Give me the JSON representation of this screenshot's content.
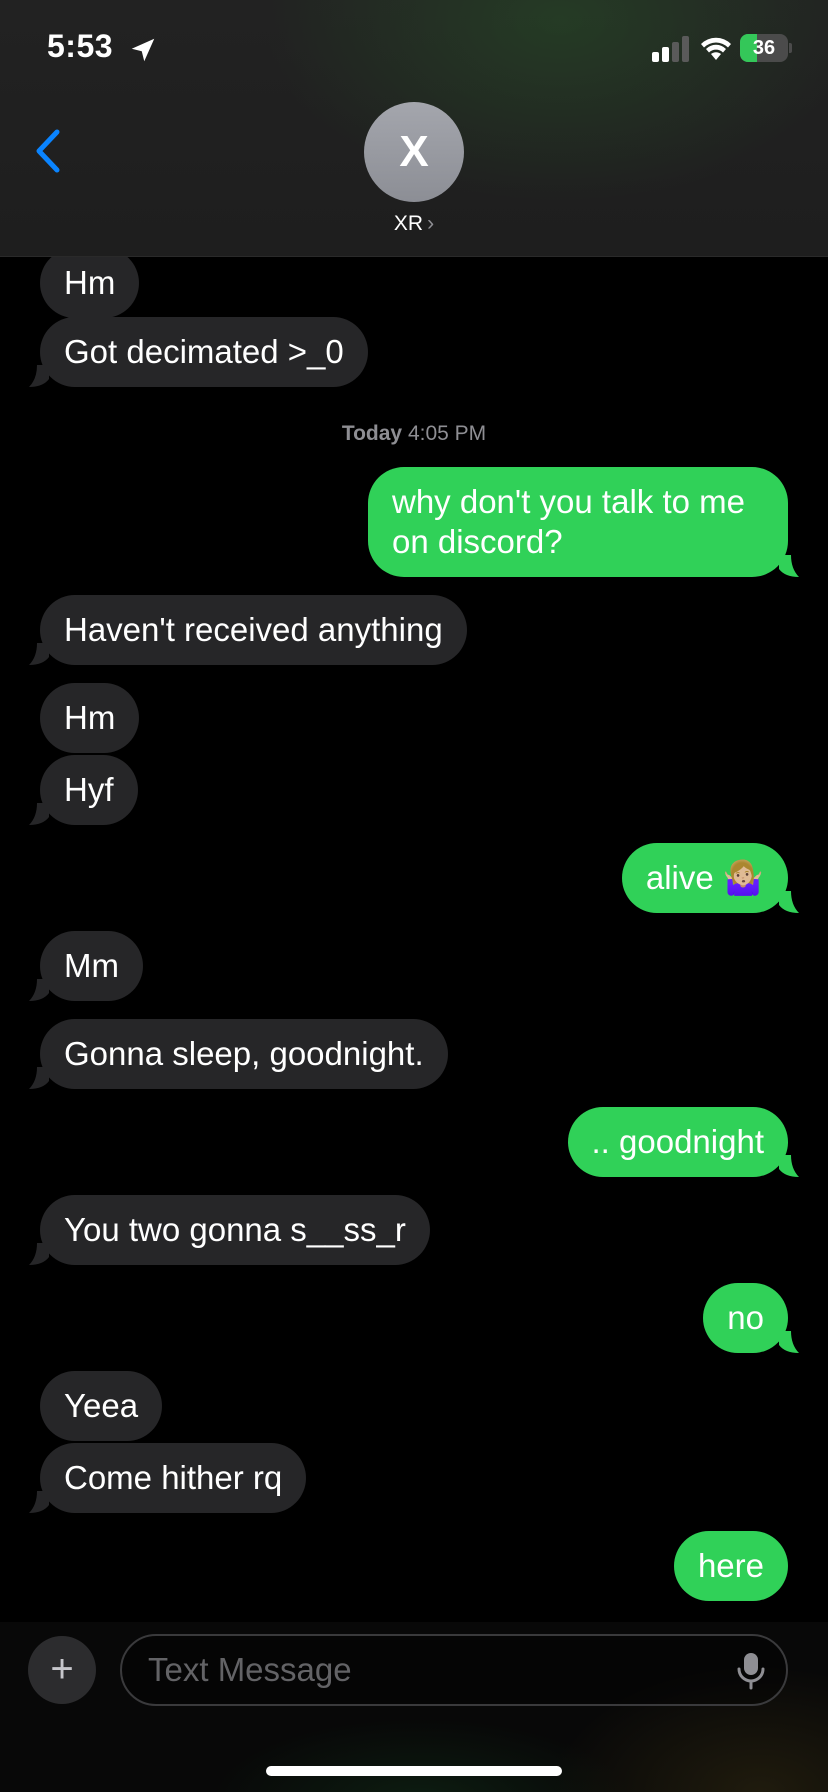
{
  "status_bar": {
    "time": "5:53",
    "battery": "36",
    "battery_level": 0.36,
    "location_icon": "location-arrow-icon",
    "signal_icon": "cellular-signal-icon",
    "wifi_icon": "wifi-icon"
  },
  "header": {
    "back_icon": "chevron-left-icon",
    "avatar_initial": "X",
    "contact_name": "XR",
    "contact_chevron": "›"
  },
  "thread": {
    "timestamp_day": "Today",
    "timestamp_time": "4:05 PM",
    "messages": [
      {
        "from": "them",
        "text": "Hm"
      },
      {
        "from": "them",
        "text": "Got decimated >_0"
      },
      {
        "from": "me",
        "text": "why don't you talk to me on discord?"
      },
      {
        "from": "them",
        "text": "Haven't received anything"
      },
      {
        "from": "them",
        "text": "Hm"
      },
      {
        "from": "them",
        "text": "Hyf"
      },
      {
        "from": "me",
        "text": "alive 🤷🏼‍♀️"
      },
      {
        "from": "them",
        "text": "Mm"
      },
      {
        "from": "them",
        "text": "Gonna sleep, goodnight."
      },
      {
        "from": "me",
        "text": ".. goodnight"
      },
      {
        "from": "them",
        "text": "You two gonna s__ss_r"
      },
      {
        "from": "me",
        "text": "no"
      },
      {
        "from": "them",
        "text": "Yeea"
      },
      {
        "from": "them",
        "text": "Come hither rq"
      },
      {
        "from": "me",
        "text": "here"
      }
    ]
  },
  "composer": {
    "plus_label": "+",
    "placeholder": "Text Message",
    "mic_icon": "microphone-icon"
  },
  "colors": {
    "outgoing_bubble": "#30d158",
    "incoming_bubble": "#262628",
    "accent_blue": "#0a84ff"
  }
}
